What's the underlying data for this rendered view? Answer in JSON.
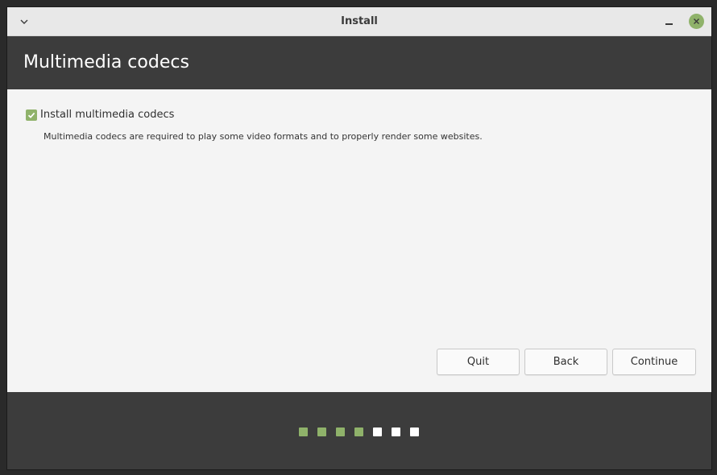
{
  "window": {
    "title": "Install",
    "close_color": "#8fb26a",
    "icons": [
      "chevron-down-icon",
      "minimize-icon",
      "close-icon"
    ]
  },
  "header": {
    "title": "Multimedia codecs"
  },
  "main": {
    "codecs_option": {
      "label": "Install multimedia codecs",
      "checked": true,
      "description": "Multimedia codecs are required to play some video formats and to properly render some websites."
    }
  },
  "buttons": {
    "quit": "Quit",
    "back": "Back",
    "continue": "Continue"
  },
  "progress": {
    "total_steps": 7,
    "completed_steps": 4,
    "completed_color": "#8fb26a",
    "pending_color": "#ffffff"
  },
  "colors": {
    "accent": "#8fb26a",
    "header_bg": "#3c3c3c",
    "content_bg": "#f4f4f4"
  }
}
